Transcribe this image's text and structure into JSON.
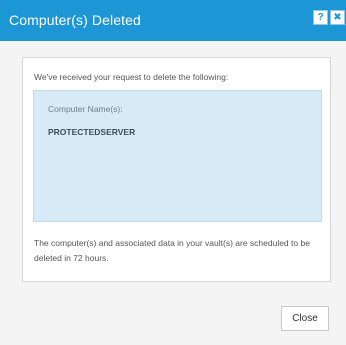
{
  "dialog": {
    "title": "Computer(s) Deleted",
    "help_icon": "?",
    "close_icon": "✖",
    "intro_text": "We've received your request to delete the following:",
    "computer_name_label": "Computer Name(s):",
    "computer_name_value": "PROTECTEDSERVER",
    "notice_text": "The computer(s) and associated data in your vault(s) are scheduled to be deleted in 72 hours.",
    "close_button_label": "Close"
  },
  "colors": {
    "title_bar": "#1d96d6",
    "info_box": "#d7ebf6"
  }
}
